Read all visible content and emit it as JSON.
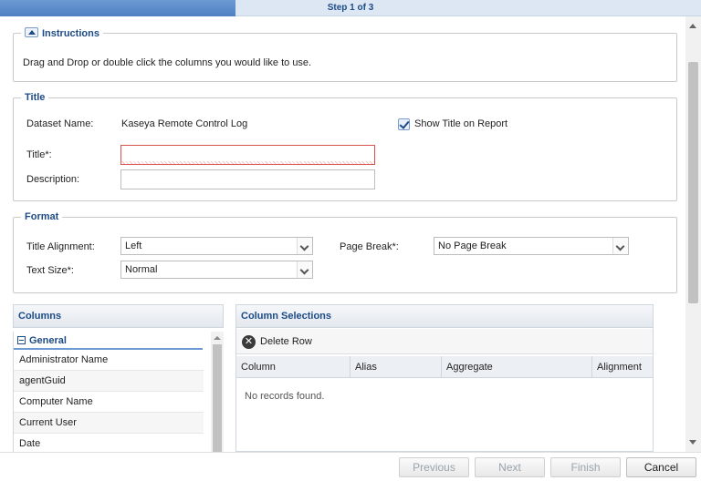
{
  "progress": {
    "label": "Step 1 of 3",
    "fraction": 0.336
  },
  "instructions": {
    "legend": "Instructions",
    "text": "Drag and Drop or double click the columns you would like to use."
  },
  "title_section": {
    "legend": "Title",
    "dataset_label": "Dataset Name:",
    "dataset_value": "Kaseya Remote Control Log",
    "show_title_label": "Show Title on Report",
    "show_title_checked": true,
    "title_label": "Title*:",
    "title_value": "",
    "description_label": "Description:",
    "description_value": ""
  },
  "format_section": {
    "legend": "Format",
    "title_alignment_label": "Title Alignment:",
    "title_alignment_value": "Left",
    "page_break_label": "Page Break*:",
    "page_break_value": "No Page Break",
    "text_size_label": "Text Size*:",
    "text_size_value": "Normal"
  },
  "columns_panel": {
    "header": "Columns",
    "group": "General",
    "items": [
      "Administrator Name",
      "agentGuid",
      "Computer Name",
      "Current User",
      "Date"
    ]
  },
  "selections_panel": {
    "header": "Column Selections",
    "delete_label": "Delete Row",
    "grid_headers": [
      "Column",
      "Alias",
      "Aggregate",
      "Alignment"
    ],
    "empty_text": "No records found."
  },
  "footer": {
    "previous": "Previous",
    "next": "Next",
    "finish": "Finish",
    "cancel": "Cancel"
  },
  "colors": {
    "accent": "#1d4b86",
    "progress": "#4f80c2",
    "error": "#d9534f"
  },
  "icons": [
    "collapse-icon",
    "checkbox-icon",
    "dropdown-icon",
    "delete-icon",
    "minus-square-icon"
  ]
}
